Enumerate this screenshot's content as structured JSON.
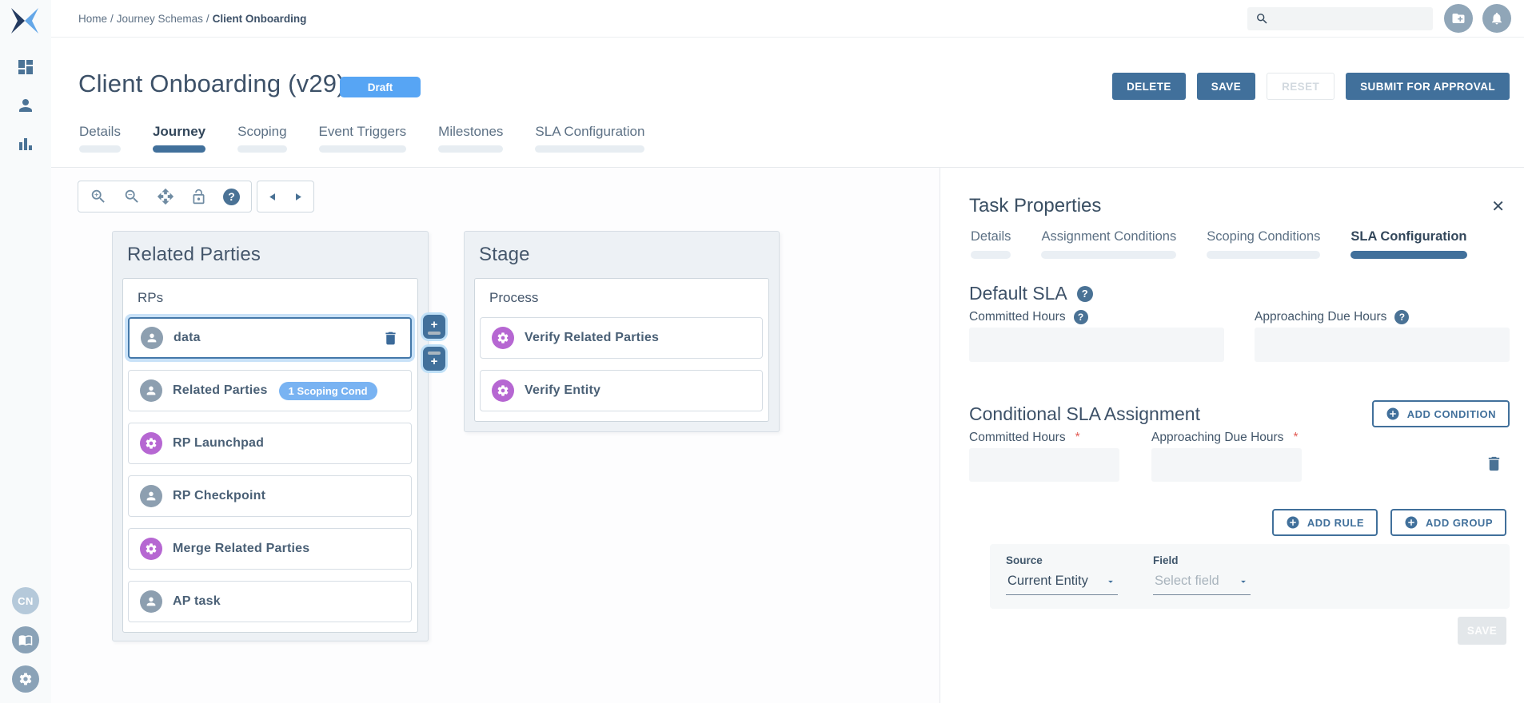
{
  "colors": {
    "primary": "#41709b",
    "accent_blue": "#57a5f4",
    "badge_blue": "#79b3f2",
    "purple": "#b667d2",
    "gray_avatar": "#8d9fb0",
    "danger": "#e25c55"
  },
  "sidebar": {
    "avatar_initials": "CN"
  },
  "topbar": {
    "breadcrumb": [
      "Home",
      "Journey Schemas",
      "Client Onboarding"
    ],
    "separator": "/"
  },
  "page": {
    "title": "Client Onboarding (v29)",
    "status": "Draft",
    "actions": {
      "delete": "DELETE",
      "save": "SAVE",
      "reset": "RESET",
      "submit": "SUBMIT FOR APPROVAL"
    }
  },
  "tabs": {
    "items": [
      {
        "label": "Details"
      },
      {
        "label": "Journey"
      },
      {
        "label": "Scoping"
      },
      {
        "label": "Event Triggers"
      },
      {
        "label": "Milestones"
      },
      {
        "label": "SLA Configuration"
      }
    ]
  },
  "canvas": {
    "plus_glyph": "+",
    "groups": [
      {
        "title": "Related Parties",
        "lane": "RPs",
        "tasks": [
          {
            "label": "data",
            "icon": "person",
            "selected": true
          },
          {
            "label": "Related Parties",
            "icon": "person",
            "badge": "1 Scoping Cond"
          },
          {
            "label": "RP Launchpad",
            "icon": "gear"
          },
          {
            "label": "RP Checkpoint",
            "icon": "person"
          },
          {
            "label": "Merge Related Parties",
            "icon": "gear"
          },
          {
            "label": "AP task",
            "icon": "person"
          }
        ]
      },
      {
        "title": "Stage",
        "lane": "Process",
        "tasks": [
          {
            "label": "Verify Related Parties",
            "icon": "gear"
          },
          {
            "label": "Verify Entity",
            "icon": "gear"
          }
        ]
      }
    ]
  },
  "panel": {
    "title": "Task Properties",
    "close": "✕",
    "help_glyph": "?",
    "tabs": [
      {
        "label": "Details"
      },
      {
        "label": "Assignment Conditions"
      },
      {
        "label": "Scoping Conditions"
      },
      {
        "label": "SLA Configuration"
      }
    ],
    "default_sla": {
      "heading": "Default SLA",
      "committed_label": "Committed Hours",
      "approaching_label": "Approaching Due Hours",
      "committed_value": "",
      "approaching_value": ""
    },
    "conditional": {
      "heading": "Conditional SLA Assignment",
      "add_condition": "ADD CONDITION",
      "committed_label": "Committed Hours",
      "approaching_label": "Approaching Due Hours",
      "required_mark": "*",
      "committed_value": "",
      "approaching_value": "",
      "add_rule": "ADD RULE",
      "add_group": "ADD GROUP",
      "rule": {
        "source_label": "Source",
        "source_value": "Current Entity",
        "field_label": "Field",
        "field_placeholder": "Select field"
      },
      "save": "SAVE"
    }
  }
}
